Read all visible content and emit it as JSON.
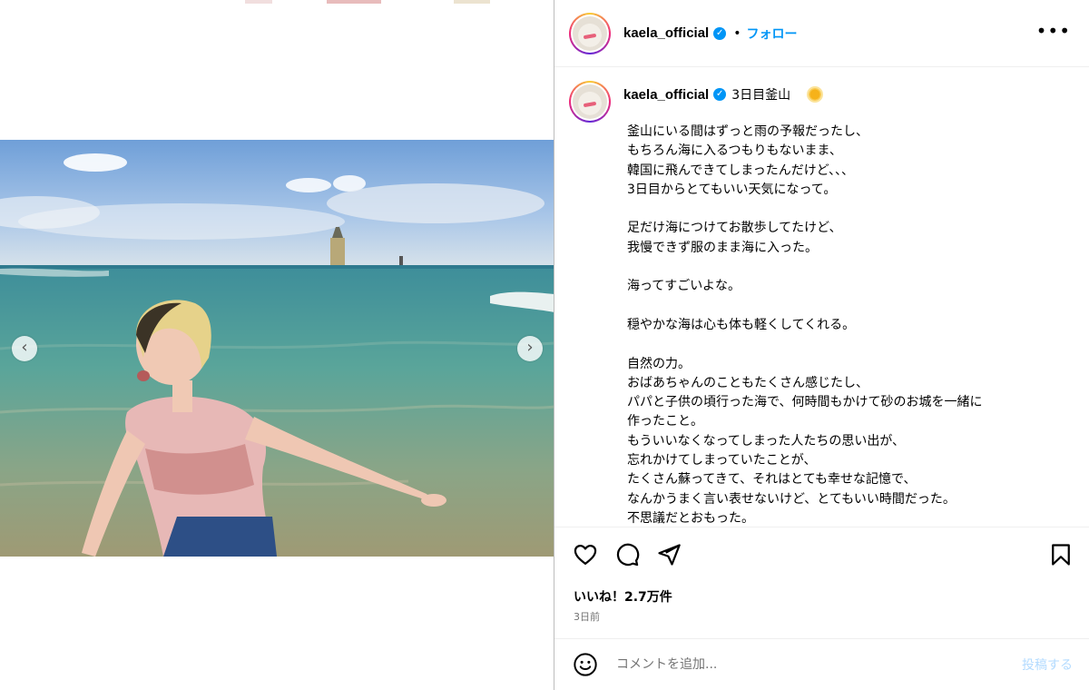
{
  "post": {
    "username": "kaela_official",
    "follow_label": "フォロー",
    "separator": "•",
    "more_label": "•••",
    "caption_title": "3日目釜山",
    "caption_text": "釜山にいる間はずっと雨の予報だったし、\nもちろん海に入るつもりもないまま、\n韓国に飛んできてしまったんだけど、、、\n3日目からとてもいい天気になって。\n\n足だけ海につけてお散歩してたけど、\n我慢できず服のまま海に入った。\n\n海ってすごいよな。\n\n穏やかな海は心も体も軽くしてくれる。\n\n自然の力。\nおばあちゃんのこともたくさん感じたし、\nパパと子供の頃行った海で、何時間もかけて砂のお城を一緒に\n作ったこと。\nもういいなくなってしまった人たちの思い出が、\n忘れかけてしまっていたことが、\nたくさん蘇ってきて、それはとても幸せな記憶で、\nなんかうまく言い表せないけど、とてもいい時間だった。\n不思議だとおもった。",
    "likes": "いいね！2.7万件",
    "time_ago": "3日前"
  },
  "media": {
    "prev_arrow": "‹",
    "next_arrow": "›"
  },
  "comment": {
    "placeholder": "コメントを追加...",
    "post_label": "投稿する"
  },
  "icons": [
    "verified-badge-icon",
    "sun-emoji-icon",
    "heart-icon",
    "comment-icon",
    "share-icon",
    "bookmark-icon",
    "emoji-icon",
    "chevron-left-icon",
    "chevron-right-icon",
    "more-icon"
  ],
  "colors": {
    "link_blue": "#0095f6",
    "post_disabled": "#b3dbff",
    "muted": "#737373"
  }
}
